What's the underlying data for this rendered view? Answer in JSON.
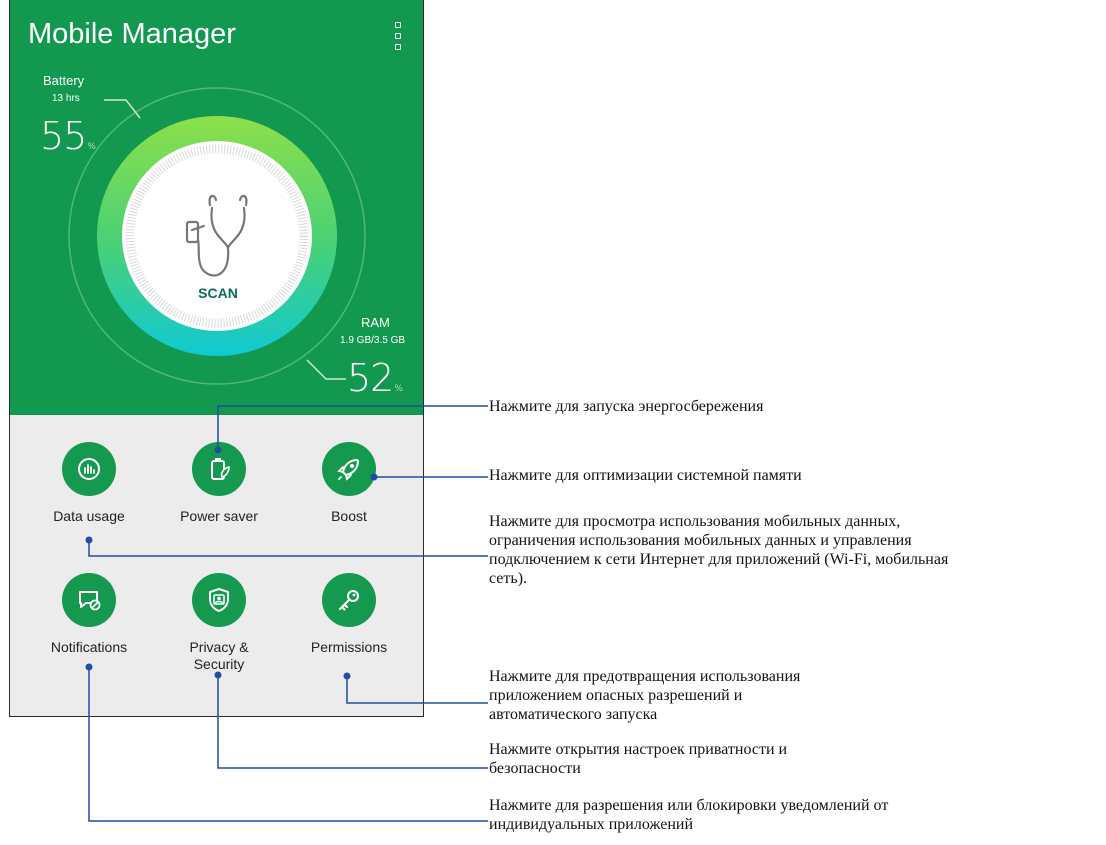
{
  "app": {
    "title": "Mobile Manager",
    "menu_icon": "more-vert-icon"
  },
  "battery": {
    "label": "Battery",
    "time": "13 hrs",
    "percent": "55",
    "unit": "%"
  },
  "ram": {
    "label": "RAM",
    "usage": "1.9 GB/3.5 GB",
    "percent": "52",
    "unit": "%"
  },
  "scan": {
    "label": "SCAN",
    "icon": "stethoscope-icon"
  },
  "tiles": [
    {
      "label": "Data usage",
      "icon": "data-usage-icon"
    },
    {
      "label": "Power saver",
      "icon": "power-saver-icon"
    },
    {
      "label": "Boost",
      "icon": "rocket-icon"
    },
    {
      "label": "Notifications",
      "icon": "notification-block-icon"
    },
    {
      "label": "Privacy &\nSecurity",
      "icon": "privacy-shield-icon"
    },
    {
      "label": "Permissions",
      "icon": "key-icon"
    }
  ],
  "callouts": {
    "power_saver": "Нажмите для запуска энергосбережения",
    "boost": "Нажмите для оптимизации системной памяти",
    "data_usage": "Нажмите для просмотра использования мобильных данных,\nограничения использования мобильных данных и управления\nподключением к сети Интернет для приложений (Wi-Fi, мобильная\nсеть).",
    "permissions": "Нажмите для предотвращения использования\nприложением опасных разрешений и\nавтоматического запуска",
    "privacy": "Нажмите открытия настроек приватности и\nбезопасности",
    "notifications": "Нажмите для разрешения или блокировки уведомлений от\nиндивидуальных приложений"
  },
  "colors": {
    "header_green": "#13994f",
    "tile_green": "#14994f",
    "panel_gray": "#ececec",
    "callout_blue": "#1f4fa0",
    "gauge_top": "#8de04a",
    "gauge_bottom": "#11c9d3"
  }
}
